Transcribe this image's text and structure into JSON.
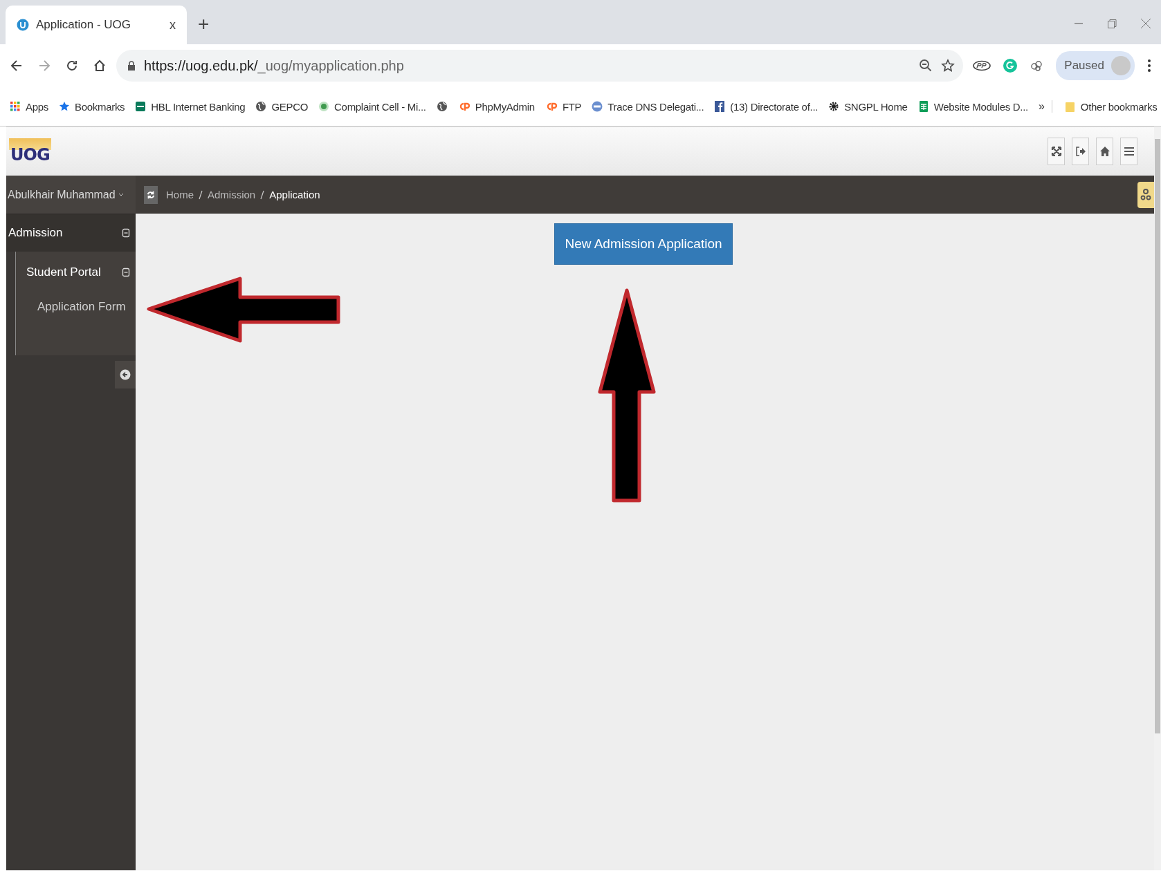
{
  "browser": {
    "tab": {
      "title": "Application - UOG",
      "close": "x"
    },
    "new_tab": "+",
    "address": {
      "host": "https://uog.edu.pk/",
      "path": "_uog/myapplication.php"
    },
    "profile": {
      "label": "Paused"
    },
    "bookmarks": [
      {
        "label": "Apps",
        "kind": "apps"
      },
      {
        "label": "Bookmarks",
        "kind": "star"
      },
      {
        "label": "HBL Internet Banking",
        "kind": "hbl"
      },
      {
        "label": "GEPCO",
        "kind": "globe"
      },
      {
        "label": "Complaint Cell - Mi...",
        "kind": "emblem"
      },
      {
        "kind": "globe"
      },
      {
        "label": "PhpMyAdmin",
        "kind": "cpanel"
      },
      {
        "label": "FTP",
        "kind": "cpanel"
      },
      {
        "label": "Trace DNS Delegati...",
        "kind": "dns"
      },
      {
        "label": "(13) Directorate of...",
        "kind": "facebook"
      },
      {
        "label": "SNGPL Home",
        "kind": "gear"
      },
      {
        "label": "Website Modules D...",
        "kind": "sheet"
      }
    ],
    "more": "»",
    "other_bookmarks": "Other bookmarks"
  },
  "app": {
    "logo": "UOG",
    "user": "Abulkhair Muhammad",
    "sidebar": {
      "items": [
        {
          "label": "Admission",
          "expanded": true,
          "children": [
            {
              "label": "Student Portal",
              "expanded": true,
              "children": [
                {
                  "label": "Application Form"
                }
              ]
            }
          ]
        }
      ]
    },
    "breadcrumbs": [
      "Home",
      "Admission",
      "Application"
    ],
    "primary_button": "New Admission Application"
  }
}
